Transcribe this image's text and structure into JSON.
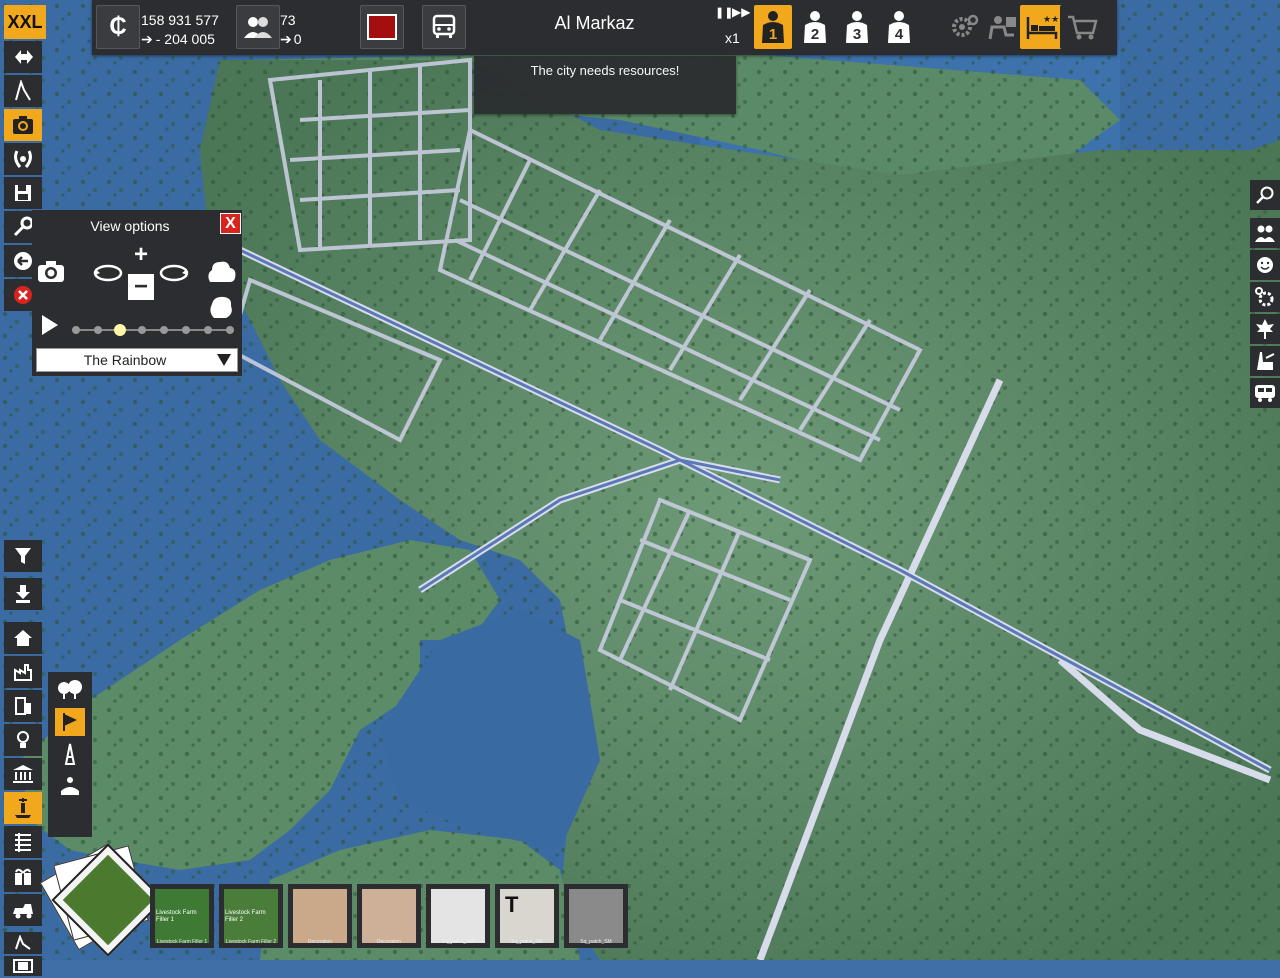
{
  "app": {
    "badge": "XXL"
  },
  "topbar": {
    "money": "158 931 577",
    "money_delta": "- 204 005",
    "population": "73",
    "population_delta": "0",
    "city_name": "Al Markaz",
    "speed": "x1",
    "speed_buttons": [
      "pause-icon",
      "fast-forward-icon"
    ],
    "levels": [
      "1",
      "2",
      "3",
      "4"
    ],
    "right_icons": [
      "settings-icon",
      "work-icon",
      "hotel-icon",
      "shop-cart-icon"
    ]
  },
  "notice": {
    "text": "The city needs resources!"
  },
  "left_toolbar": {
    "items": [
      "move-icon",
      "road-tool-icon",
      "camera-icon",
      "laurel-icon",
      "save-icon",
      "wrench-icon",
      "undo-icon",
      "cancel-icon"
    ],
    "active": "camera-icon"
  },
  "view_options": {
    "title": "View options",
    "close_label": "X",
    "selected_style": "The Rainbow",
    "slider_steps": 8,
    "slider_selected": 3
  },
  "right_toolbar": {
    "items": [
      "search-icon",
      "people-icon",
      "happiness-icon",
      "gear-icon",
      "nature-icon",
      "industry-icon",
      "transport-icon"
    ]
  },
  "category_bar": {
    "items": [
      "filter-icon",
      "download-icon",
      "house-icon",
      "factory-icon",
      "office-icon",
      "education-icon",
      "government-icon",
      "decoration-icon",
      "list-icon",
      "gift-icon",
      "vehicle-icon"
    ],
    "active": "decoration-icon",
    "bottom": [
      "road-tool-icon",
      "film-icon"
    ]
  },
  "sub_bar": {
    "items": [
      "trees-icon",
      "flag-icon",
      "monument-icon",
      "fountain-icon"
    ],
    "active": "flag-icon"
  },
  "cards": [
    {
      "title": "Livestock Farm Filler 1",
      "caption": "Livestock Farm Filler 1",
      "bg": "#3f7a35"
    },
    {
      "title": "Livestock Farm Filler 2",
      "caption": "Livestock Farm Filler 2",
      "bg": "#4a7c3a"
    },
    {
      "title": "",
      "caption": "Decoration",
      "bg": "#c9a98a"
    },
    {
      "title": "",
      "caption": "Decoration",
      "bg": "#cdb097"
    },
    {
      "title": "",
      "caption": "Sq_patch_SM",
      "bg": "#e4e4e4"
    },
    {
      "title": "T",
      "caption": "Sq_patch_SM",
      "bg": "#d9d6cf"
    },
    {
      "title": "",
      "caption": "Sq_patch_SM",
      "bg": "#8a8a8a"
    }
  ],
  "colors": {
    "accent": "#f2a81d",
    "panel": "#2b2d30",
    "water": "#3f6fa6",
    "land": "#4f7f5f",
    "road": "#c9cde0"
  }
}
